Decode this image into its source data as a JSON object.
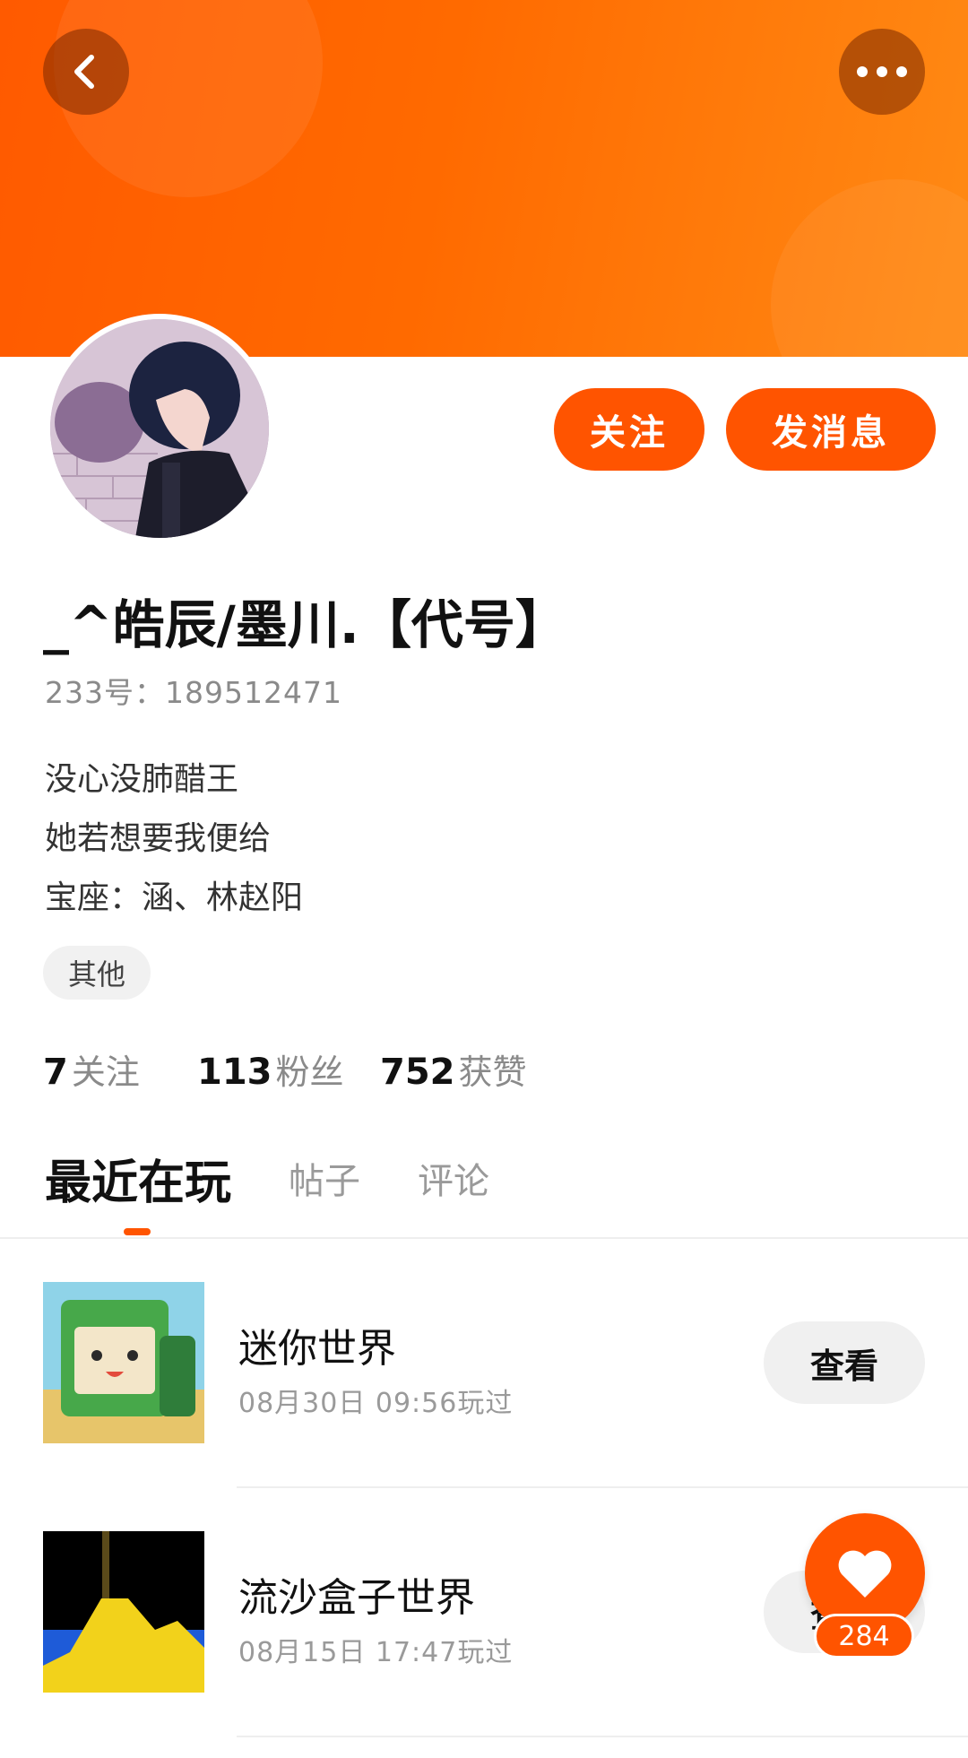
{
  "profile": {
    "username": "_^皓辰/墨川.【代号】",
    "uid": "233号：189512471",
    "bio": [
      "没心没肺醋王",
      "她若想要我便给",
      "宝座：涵、林赵阳"
    ],
    "tag": "其他"
  },
  "actions": {
    "follow": "关注",
    "message": "发消息"
  },
  "stats": [
    {
      "num": "7",
      "label": "关注"
    },
    {
      "num": "113",
      "label": "粉丝"
    },
    {
      "num": "752",
      "label": "获赞"
    }
  ],
  "tabs": [
    "最近在玩",
    "帖子",
    "评论"
  ],
  "games": [
    {
      "name": "迷你世界",
      "time": "08月30日 09:56玩过",
      "button": "查看"
    },
    {
      "name": "流沙盒子世界",
      "time": "08月15日 17:47玩过",
      "button": "查看"
    }
  ],
  "like": {
    "count": "284"
  },
  "colors": {
    "accent": "#ff5400",
    "banner_start": "#ff5a00",
    "banner_end": "#ff8a14"
  },
  "icons": {
    "back": "chevron-left-icon",
    "more": "more-dots-icon",
    "like": "heart-icon"
  }
}
